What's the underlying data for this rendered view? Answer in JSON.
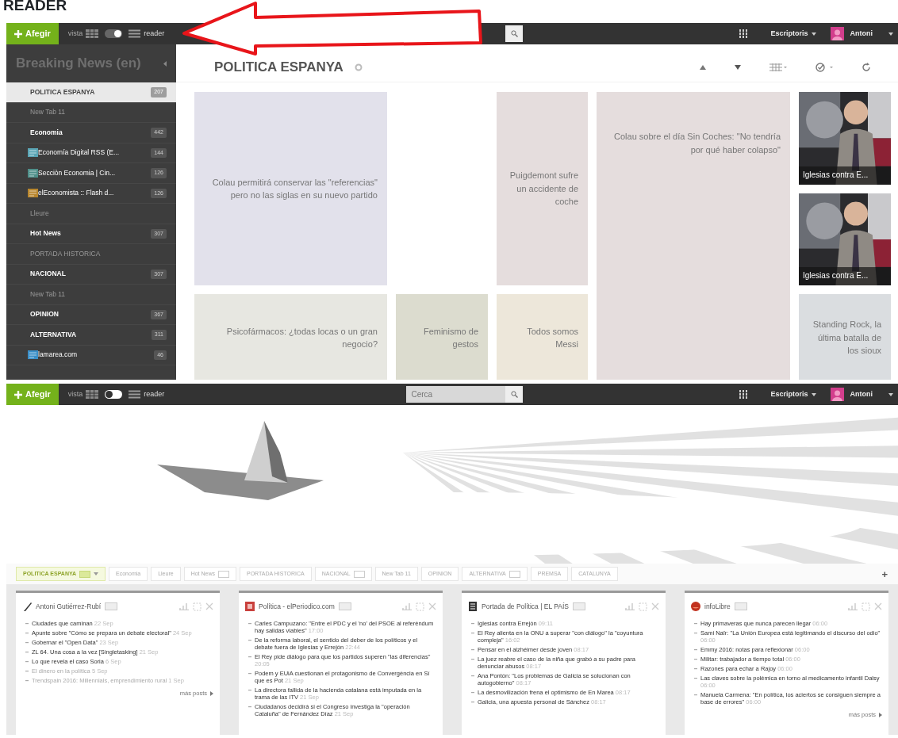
{
  "heading": "READER",
  "reader_view": {
    "topbar": {
      "add_button": "Afegir",
      "view_label": "vista",
      "reader_label": "reader",
      "reader_mode": true,
      "desktops": "Escriptoris",
      "user": "Antoni"
    },
    "sidebar": {
      "title": "Breaking News (en)",
      "items": [
        {
          "label": "POLITICA ESPANYA",
          "badge": "207",
          "selected": true,
          "dimmed": false
        },
        {
          "label": "New Tab 11",
          "selected": false,
          "dimmed": true
        },
        {
          "label": "Economia",
          "badge": "442",
          "selected": false,
          "dimmed": false,
          "children": [
            {
              "label": "Economía Digital RSS (E...",
              "badge": "144",
              "color": "#5aa5b5"
            },
            {
              "label": "Secciòn Economia | Cin...",
              "badge": "126",
              "color": "#4f8f8a"
            },
            {
              "label": "elEconomista :: Flash d...",
              "badge": "126",
              "color": "#b8862e"
            }
          ]
        },
        {
          "label": "Lleure",
          "selected": false,
          "dimmed": true
        },
        {
          "label": "Hot News",
          "badge": "307",
          "selected": false,
          "dimmed": false
        },
        {
          "label": "PORTADA HISTORICA",
          "selected": false,
          "dimmed": true
        },
        {
          "label": "NACIONAL",
          "badge": "307",
          "selected": false,
          "dimmed": false
        },
        {
          "label": "New Tab 11",
          "selected": false,
          "dimmed": true
        },
        {
          "label": "OPINION",
          "badge": "367",
          "selected": false,
          "dimmed": false
        },
        {
          "label": "ALTERNATIVA",
          "badge": "311",
          "selected": false,
          "dimmed": false,
          "children": [
            {
              "label": "lamarea.com",
              "badge": "46",
              "color": "#3a8fc8"
            }
          ]
        }
      ]
    },
    "board": {
      "title": "POLITICA ESPANYA",
      "tiles": [
        {
          "kind": "text",
          "text": "Colau permitirá conservar las \"referencias\" pero no las siglas en su nuevo partido",
          "color": "#e2e1eb"
        },
        {
          "kind": "text",
          "text": "Puigdemont sufre un accidente de coche",
          "color": "#e5dddd"
        },
        {
          "kind": "text",
          "text": "Colau sobre el día Sin Coches: \"No tendría por qué haber colapso\"",
          "color": "#e5dddd"
        },
        {
          "kind": "picture",
          "caption": "Iglesias contra E..."
        },
        {
          "kind": "picture",
          "caption": "Iglesias contra E..."
        },
        {
          "kind": "text",
          "text": "Psicofármacos: ¿todas locas o un gran negocio?",
          "color": "#e7e7e1"
        },
        {
          "kind": "text",
          "text": "Feminismo de gestos",
          "color": "#dcdccf"
        },
        {
          "kind": "text",
          "text": "Todos somos Messi",
          "color": "#ede7da"
        },
        {
          "kind": "text",
          "text": "Standing Rock, la última batalla de los sioux",
          "color": "#dadde0"
        }
      ]
    }
  },
  "home_view": {
    "topbar": {
      "add_button": "Afegir",
      "view_label": "vista",
      "reader_label": "reader",
      "reader_mode": false,
      "search": {
        "placeholder": "Cerca"
      },
      "desktops": "Escriptoris",
      "user": "Antoni"
    },
    "tabs": [
      {
        "label": "POLITICA ESPANYA",
        "selected": true,
        "badge": true
      },
      {
        "label": "Economia",
        "selected": false,
        "badge": false
      },
      {
        "label": "Lleure",
        "selected": false,
        "badge": false
      },
      {
        "label": "Hot News",
        "selected": false,
        "badge": true
      },
      {
        "label": "PORTADA HISTORICA",
        "selected": false,
        "badge": false
      },
      {
        "label": "NACIONAL",
        "selected": false,
        "badge": true
      },
      {
        "label": "New Tab 11",
        "selected": false,
        "badge": false
      },
      {
        "label": "OPINION",
        "selected": false,
        "badge": false
      },
      {
        "label": "ALTERNATIVA",
        "selected": false,
        "badge": true
      },
      {
        "label": "PREMSA",
        "selected": false,
        "badge": false
      },
      {
        "label": "CATALUNYA",
        "selected": false,
        "badge": false
      }
    ],
    "add_tab": "+",
    "widgets": [
      {
        "title": "Antoni Gutiérrez-Rubí",
        "kind": "pen",
        "more": "más posts",
        "items": [
          {
            "text": "Ciudades que caminan",
            "time": "22 Sep",
            "read": false
          },
          {
            "text": "Apunte sobre \"Cómo se prepara un debate electoral\"",
            "time": "24 Sep",
            "read": false
          },
          {
            "text": "Gobernar el \"Open Data\"",
            "time": "23 Sep",
            "read": false
          },
          {
            "text": "ZL 64. Una cosa a la vez [Singletasking]",
            "time": "21 Sep",
            "read": false
          },
          {
            "text": "Lo que revela el caso Soria",
            "time": "6 Sep",
            "read": false
          },
          {
            "text": "El dinero en la política",
            "time": "5 Sep",
            "read": true
          },
          {
            "text": "Trendspain 2016: Millennials, emprendimiento rural",
            "time": "1 Sep",
            "read": true
          }
        ]
      },
      {
        "title": "Política - elPeriodico.com",
        "kind": "tile",
        "items": [
          {
            "text": "Carles Campuzano: \"Entre el PDC y el 'no' del PSOE al referéndum hay salidas viables\"",
            "time": "17:00",
            "read": false
          },
          {
            "text": "De la reforma laboral, el sentido del deber de los políticos y el debate fuera de Iglesias y Errejón",
            "time": "22:44",
            "read": false
          },
          {
            "text": "El Rey pide diálogo para que los partidos superen \"las diferencias\"",
            "time": "20:05",
            "read": false
          },
          {
            "text": "Podem y EUiA cuestionan el protagonismo de Convergència en Sí que es Pot",
            "time": "21 Sep",
            "read": false
          },
          {
            "text": "La directora fallida de la hacienda catalana está imputada en la trama de las ITV",
            "time": "21 Sep",
            "read": false
          },
          {
            "text": "Ciudadanos decidirá si el Congreso investiga la \"operación Cataluña\" de Fernández Díaz",
            "time": "21 Sep",
            "read": false
          }
        ]
      },
      {
        "title": "Portada de Política | EL PAÍS",
        "kind": "book",
        "items": [
          {
            "text": "Iglesias contra Errejón",
            "time": "09:11",
            "read": false
          },
          {
            "text": "El Rey alienta en la ONU a superar \"con diálogo\" la \"coyuntura compleja\"",
            "time": "16:02",
            "read": false
          },
          {
            "text": "Pensar en el alzhéimer desde joven",
            "time": "08:17",
            "read": false
          },
          {
            "text": "La juez reabre el caso de la niña que grabó a su padre para denunciar abusos",
            "time": "08:17",
            "read": false
          },
          {
            "text": "Ana Pontón: \"Los problemas de Galicia se solucionan con autogobierno\"",
            "time": "08:17",
            "read": false
          },
          {
            "text": "La desmovilización frena el optimismo de En Marea",
            "time": "08:17",
            "read": false
          },
          {
            "text": "Galicia, una apuesta personal de Sánchez",
            "time": "08:17",
            "read": false
          }
        ]
      },
      {
        "title": "infoLibre",
        "kind": "circle",
        "more": "más posts",
        "items": [
          {
            "text": "Hay primaveras que nunca parecen llegar",
            "time": "06:00",
            "read": false
          },
          {
            "text": "Sami Naïr: \"La Unión Europea está legitimando el discurso del odio\"",
            "time": "06:00",
            "read": false
          },
          {
            "text": "Emmy 2016: notas para reflexionar",
            "time": "06:00",
            "read": false
          },
          {
            "text": "Militar: trabajador a tiempo total",
            "time": "06:00",
            "read": false
          },
          {
            "text": "Razones para echar a Rajoy",
            "time": "06:00",
            "read": false
          },
          {
            "text": "Las claves sobre la polémica en torno al medicamento infantil Dalsy",
            "time": "06:00",
            "read": false
          },
          {
            "text": "Manuela Carmena: \"En política, los aciertos se consiguen siempre a base de errores\"",
            "time": "06:00",
            "read": false
          }
        ]
      }
    ]
  }
}
